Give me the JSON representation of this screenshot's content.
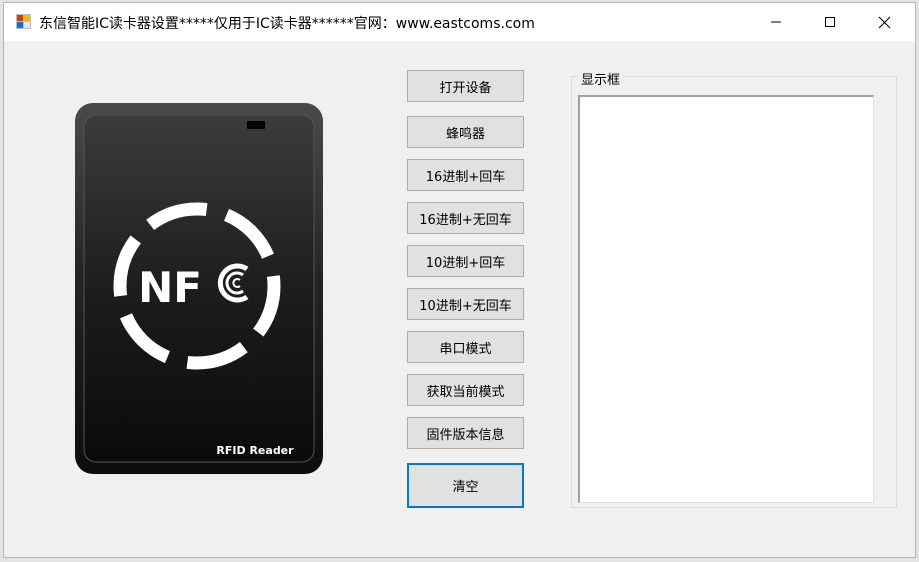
{
  "window": {
    "title": "东信智能IC读卡器设置*****仅用于IC读卡器******官网：www.eastcoms.com",
    "controls": [
      "minimize-icon",
      "maximize-icon",
      "close-icon"
    ]
  },
  "reader_image": {
    "brand_text": "NFC",
    "caption": "RFID Reader"
  },
  "buttons": {
    "open_device": "打开设备",
    "buzzer": "蜂鸣器",
    "hex_enter": "16进制+回车",
    "hex_no_enter": "16进制+无回车",
    "dec_enter": "10进制+回车",
    "dec_no_enter": "10进制+无回车",
    "serial_mode": "串口模式",
    "get_mode": "获取当前模式",
    "firmware": "固件版本信息",
    "clear": "清空"
  },
  "display": {
    "label": "显示框",
    "content": ""
  },
  "colors": {
    "focus_border": "#0078d7",
    "button_bg": "#e1e1e1",
    "window_bg": "#f0f0f0"
  }
}
